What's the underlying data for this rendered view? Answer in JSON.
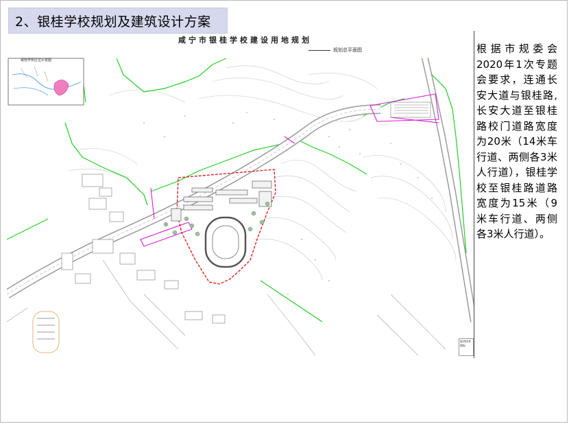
{
  "slide": {
    "title": "2、银桂学校规划及建筑设计方案"
  },
  "map": {
    "title": "咸宁市银桂学校建设用地规划",
    "subtitle": "规划总平面图",
    "inset_title": "银桂学校区位示意图",
    "legend_title": "经济技术指标"
  },
  "description": {
    "text": "根据市规委会2020年1次专题会要求，连通长安大道与银桂路,长安大道至银桂路校门道路宽度为20米（14米车行道、两侧各3米人行道），银桂学校至银桂路道路宽度为15米（9米车行道、两侧各3米人行道）。"
  },
  "colors": {
    "title_bg": "#d6d8ee",
    "boundary_green": "#22cc22",
    "road_magenta": "#d61bd6",
    "site_red": "#e01010",
    "contour_grey": "#b0b0b0",
    "building_grey": "#8a8a8a"
  }
}
